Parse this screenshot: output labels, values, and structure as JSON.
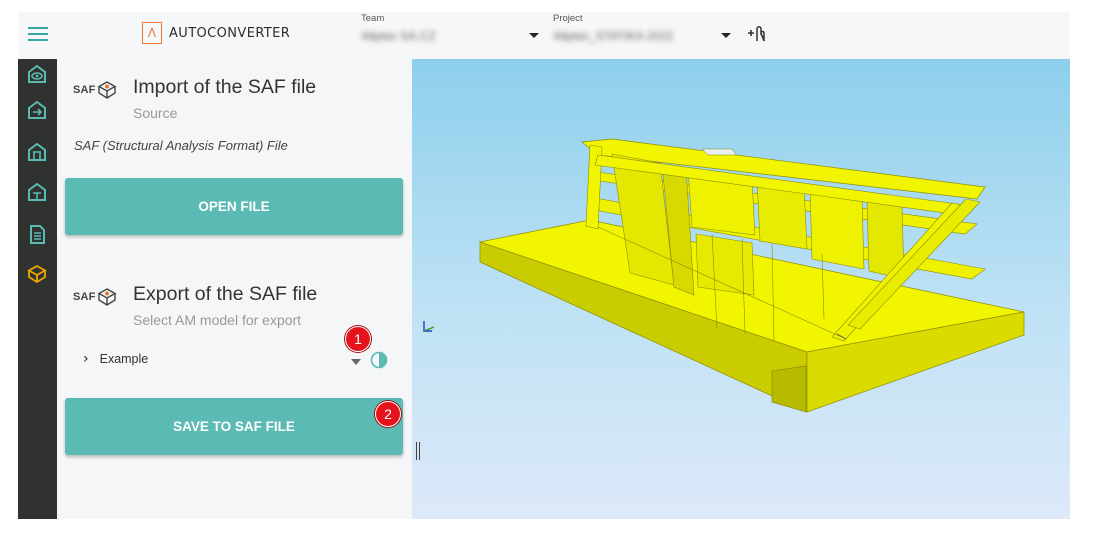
{
  "header": {
    "logo_glyph": "Λ",
    "app_name": "AUTOCONVERTER",
    "team": {
      "label": "Team",
      "value": "Allplan SA.CZ"
    },
    "project": {
      "label": "Project",
      "value": "Allplan_STATIKA 2022"
    }
  },
  "sidebar": {
    "icons": [
      "view-model-icon",
      "export-model-icon",
      "structure-icon",
      "structure-alt-icon",
      "document-icon",
      "saf-cube-icon"
    ],
    "active_icon": "saf-cube-icon"
  },
  "import_section": {
    "saf_logo": "SAF",
    "title": "Import of the SAF file",
    "subtitle": "Source",
    "format_text": "SAF (Structural Analysis Format) File",
    "open_button": "OPEN FILE"
  },
  "export_section": {
    "saf_logo": "SAF",
    "title": "Export of the SAF file",
    "subtitle": "Select AM model for export",
    "tree_item": "Example",
    "save_button": "SAVE TO SAF FILE"
  },
  "annotations": [
    "1",
    "2"
  ],
  "colors": {
    "accent": "#5bbab3",
    "logo": "#e9793b",
    "rail": "#2f322f",
    "model": "#f2f500",
    "badge": "#e5141c"
  }
}
